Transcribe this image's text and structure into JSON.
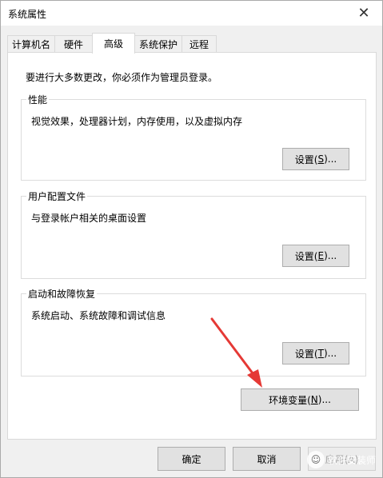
{
  "window": {
    "title": "系统属性",
    "close_glyph": "✕"
  },
  "tabs": [
    {
      "label": "计算机名"
    },
    {
      "label": "硬件"
    },
    {
      "label": "高级"
    },
    {
      "label": "系统保护"
    },
    {
      "label": "远程"
    }
  ],
  "advanced": {
    "intro": "要进行大多数更改，你必须作为管理员登录。",
    "performance": {
      "title": "性能",
      "desc": "视觉效果，处理器计划，内存使用，以及虚拟内存",
      "button": {
        "prefix": "设置(",
        "key": "S",
        "suffix": ")..."
      }
    },
    "user_profiles": {
      "title": "用户配置文件",
      "desc": "与登录帐户相关的桌面设置",
      "button": {
        "prefix": "设置(",
        "key": "E",
        "suffix": ")..."
      }
    },
    "startup_recovery": {
      "title": "启动和故障恢复",
      "desc": "系统启动、系统故障和调试信息",
      "button": {
        "prefix": "设置(",
        "key": "T",
        "suffix": ")..."
      }
    },
    "env_button": {
      "prefix": "环境变量(",
      "key": "N",
      "suffix": ")..."
    }
  },
  "footer": {
    "ok": "确定",
    "cancel": "取消",
    "apply": "应用(A)"
  },
  "watermark": {
    "text": "软件安装师"
  },
  "colors": {
    "arrow": "#e53935",
    "panel_bg": "#ffffff",
    "window_bg": "#f0f0f0"
  }
}
